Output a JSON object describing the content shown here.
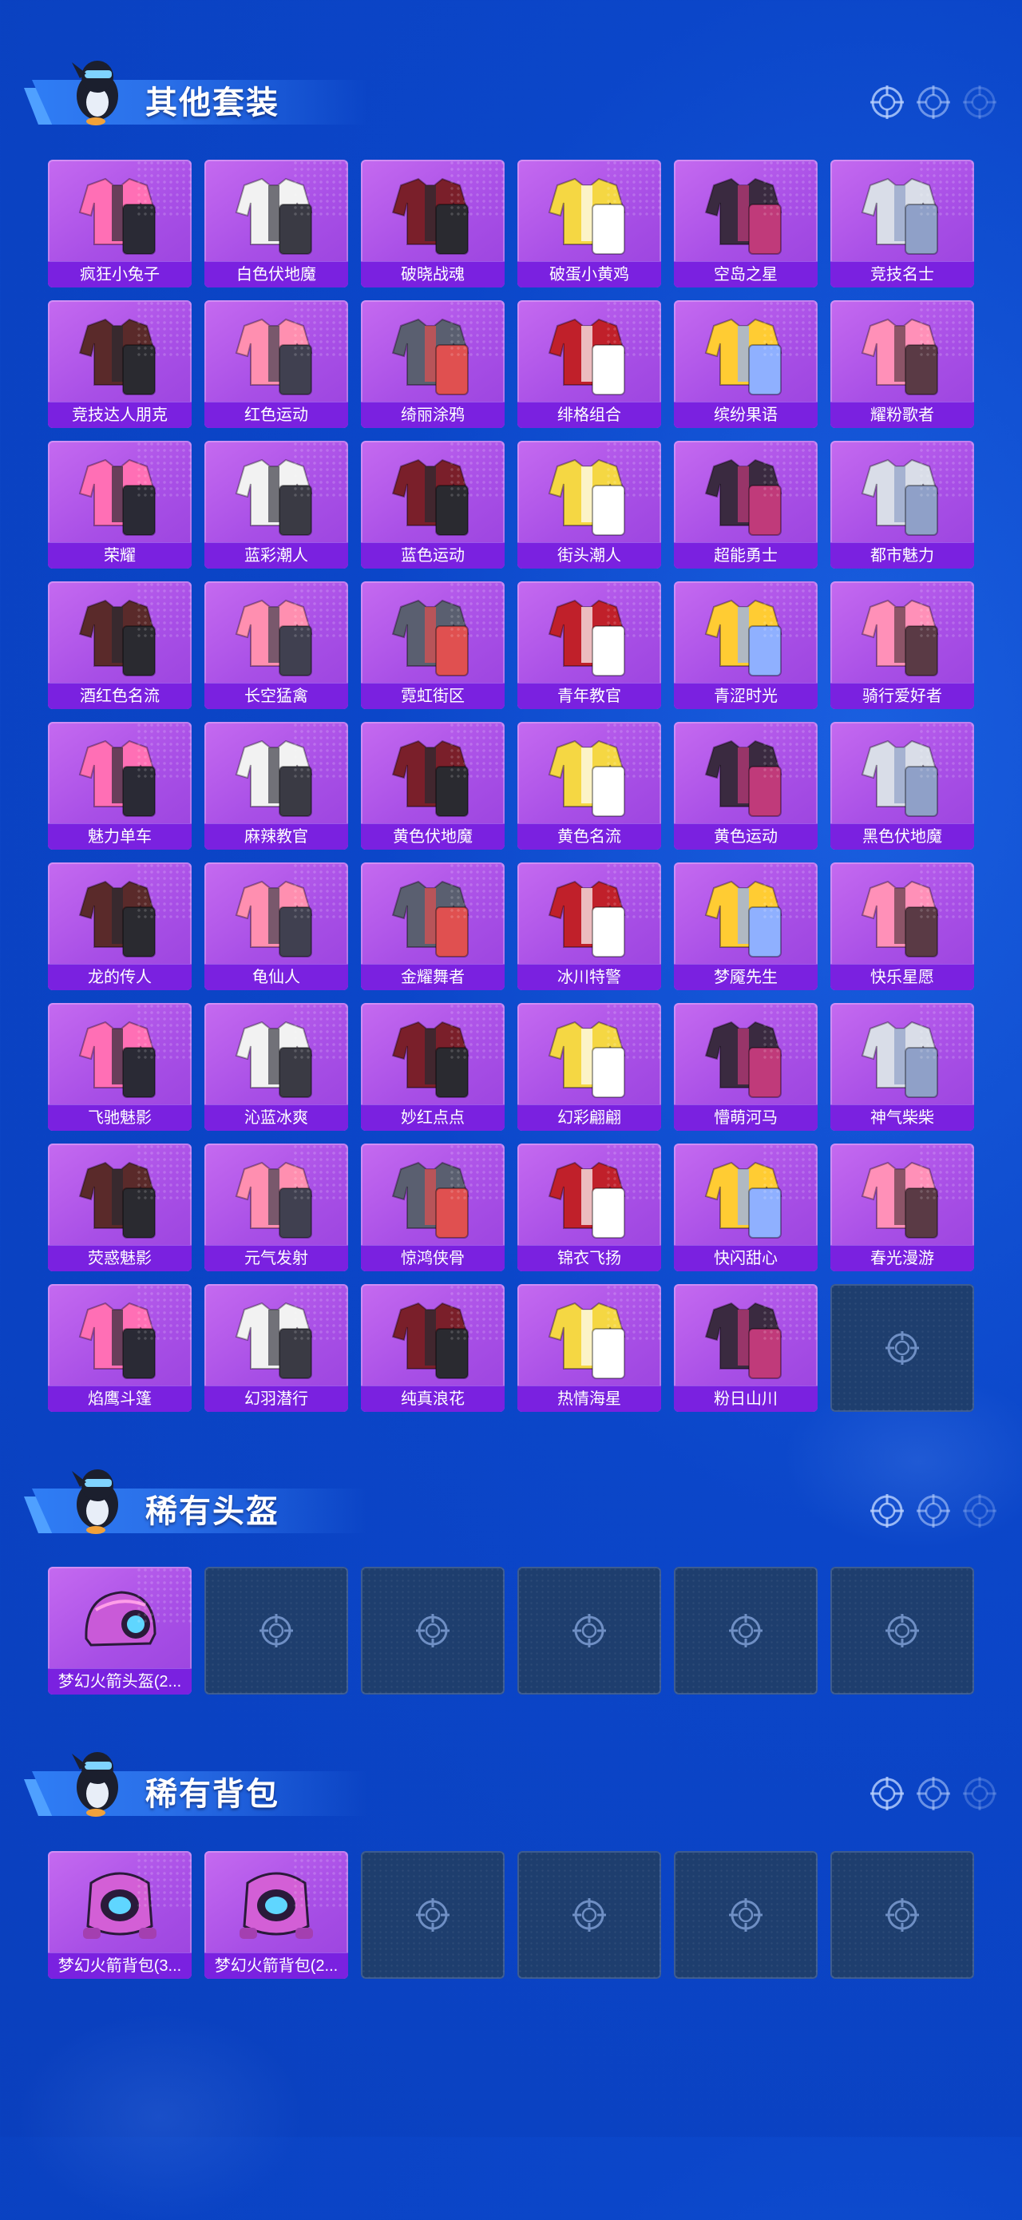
{
  "sections": [
    {
      "title": "其他套装",
      "items": [
        "疯狂小兔子",
        "白色伏地魔",
        "破晓战魂",
        "破蛋小黄鸡",
        "空岛之星",
        "竞技名士",
        "竞技达人朋克",
        "红色运动",
        "绮丽涂鸦",
        "绯格组合",
        "缤纷果语",
        "耀粉歌者",
        "荣耀",
        "蓝彩潮人",
        "蓝色运动",
        "街头潮人",
        "超能勇士",
        "都市魅力",
        "酒红色名流",
        "长空猛禽",
        "霓虹街区",
        "青年教官",
        "青涩时光",
        "骑行爱好者",
        "魅力单车",
        "麻辣教官",
        "黄色伏地魔",
        "黄色名流",
        "黄色运动",
        "黑色伏地魔",
        "龙的传人",
        "龟仙人",
        "金耀舞者",
        "冰川特警",
        "梦魇先生",
        "快乐星愿",
        "飞驰魅影",
        "沁蓝冰爽",
        "妙红点点",
        "幻彩翩翩",
        "懵萌河马",
        "神气柴柴",
        "荧惑魅影",
        "元气发射",
        "惊鸿侠骨",
        "锦衣飞扬",
        "快闪甜心",
        "春光漫游",
        "焰鹰斗篷",
        "幻羽潜行",
        "纯真浪花",
        "热情海星",
        "粉日山川"
      ],
      "empty_slots": 1
    },
    {
      "title": "稀有头盔",
      "items": [
        "梦幻火箭头盔(2..."
      ],
      "empty_slots": 5
    },
    {
      "title": "稀有背包",
      "items": [
        "梦幻火箭背包(3...",
        "梦幻火箭背包(2..."
      ],
      "empty_slots": 4
    }
  ],
  "icons": {
    "header_decoration": [
      "crosshair-icon",
      "crosshair-icon",
      "crosshair-icon"
    ],
    "empty_slot": "crosshair-icon",
    "mascot": "penguin-mascot-icon"
  },
  "colors": {
    "background": "#0a3fbd",
    "card": "#a84fe6",
    "card_label": "#7a21e0",
    "empty_slot": "#1e3e6e"
  }
}
